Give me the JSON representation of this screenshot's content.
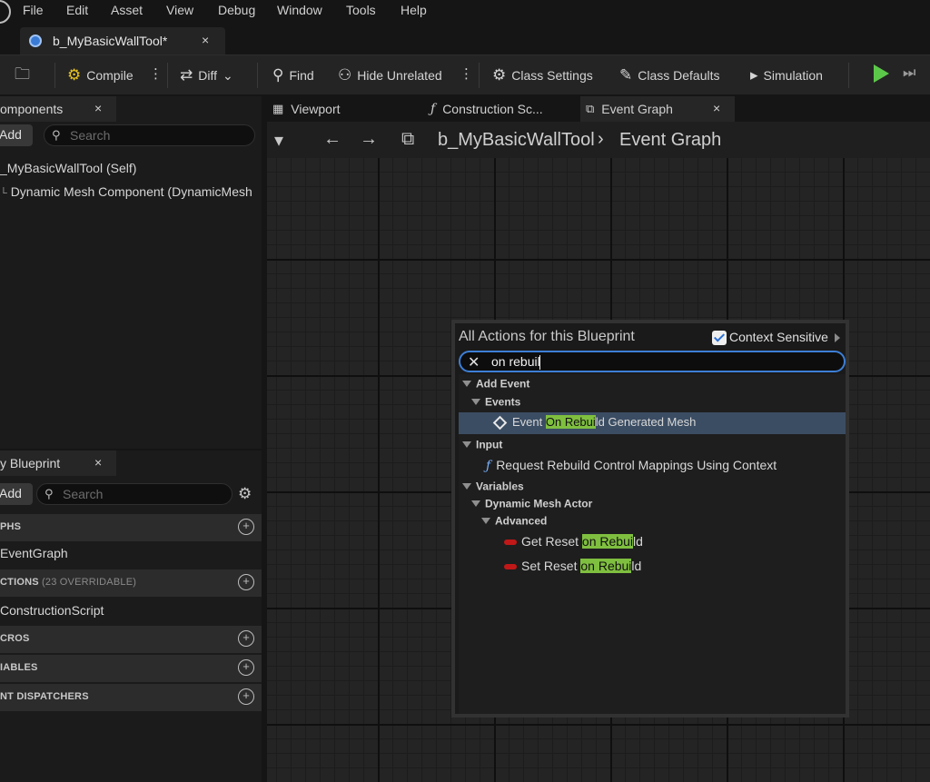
{
  "menu": [
    "File",
    "Edit",
    "Asset",
    "View",
    "Debug",
    "Window",
    "Tools",
    "Help"
  ],
  "asset_tab": {
    "label": "b_MyBasicWallTool*",
    "close": "×"
  },
  "toolbar": {
    "compile": "Compile",
    "diff": "Diff",
    "find": "Find",
    "hide_unrelated": "Hide Unrelated",
    "class_settings": "Class Settings",
    "class_defaults": "Class Defaults",
    "simulation": "Simulation"
  },
  "components": {
    "tab_label": "omponents",
    "close": "×",
    "add": "Add",
    "search_placeholder": "Search",
    "tree": [
      "_MyBasicWallTool (Self)",
      "Dynamic Mesh Component (DynamicMesh"
    ]
  },
  "my_blueprint": {
    "tab_label": "y Blueprint",
    "close": "×",
    "add": "Add",
    "search_placeholder": "Search",
    "sections": {
      "graphs": "PHS",
      "graph_item": "EventGraph",
      "functions": "CTIONS",
      "functions_count": "(23 OVERRIDABLE)",
      "function_item": "ConstructionScript",
      "macros": "CROS",
      "variables": "IABLES",
      "dispatchers": "NT DISPATCHERS"
    }
  },
  "graph_tabs": [
    {
      "label": "Viewport"
    },
    {
      "label": "Construction Sc..."
    },
    {
      "label": "Event Graph",
      "close": "×"
    }
  ],
  "breadcrumb": {
    "blueprint": "b_MyBasicWallTool",
    "separator": "›",
    "graph": "Event Graph"
  },
  "action_menu": {
    "title": "All Actions for this Blueprint",
    "context_sensitive": "Context Sensitive",
    "query": "on rebuil",
    "cat_add_event": "Add Event",
    "cat_events": "Events",
    "event_pre": "Event ",
    "event_hl": "On Rebui",
    "event_post": "ld Generated Mesh",
    "cat_input": "Input",
    "input_item": "Request Rebuild Control Mappings Using Context",
    "cat_variables": "Variables",
    "cat_dma": "Dynamic Mesh Actor",
    "cat_advanced": "Advanced",
    "get_pre": "Get Reset ",
    "set_pre": "Set Reset ",
    "var_hl": "on Rebui",
    "var_post": "ld"
  },
  "colors": {
    "play": "#5cc84a",
    "highlight": "#7fbf3f",
    "selection": "#3b4d63",
    "search_border": "#3d7fd6"
  }
}
